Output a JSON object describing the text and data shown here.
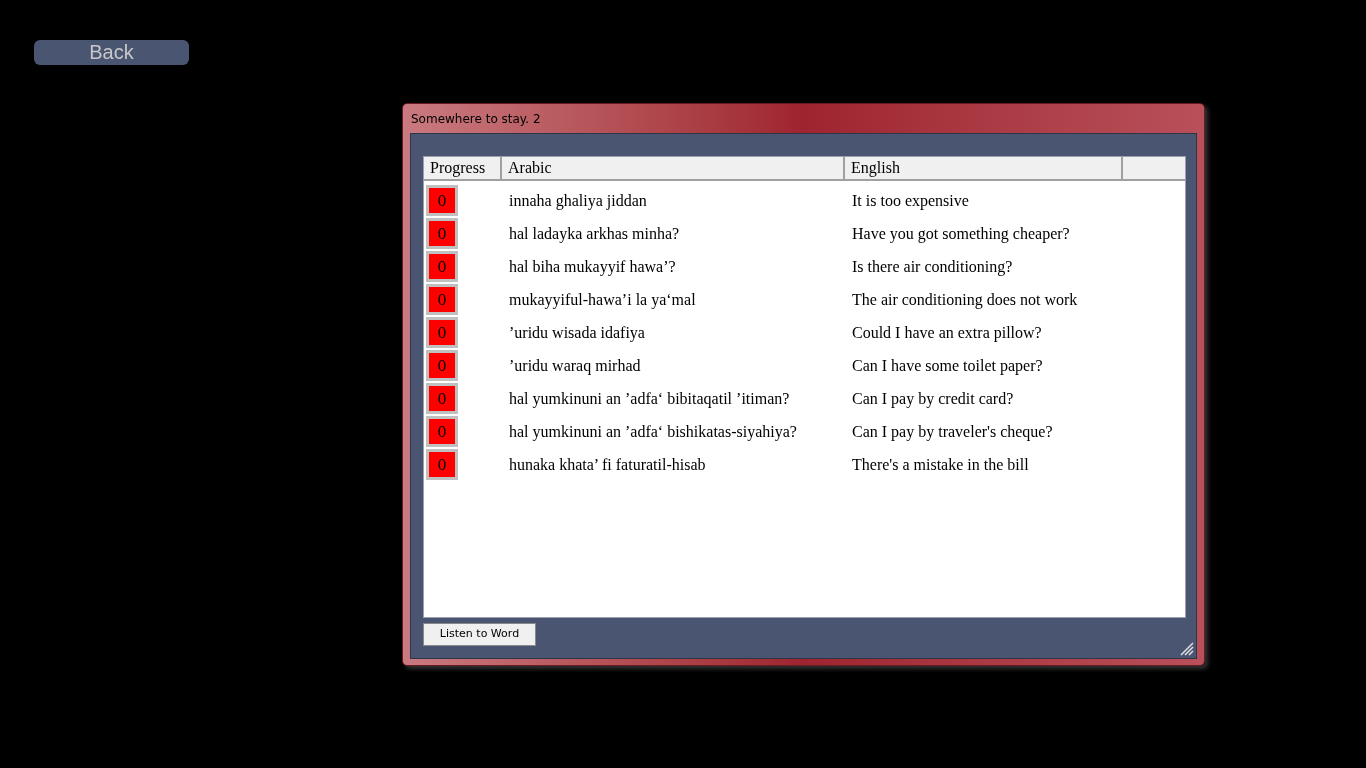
{
  "back_button": "Back",
  "window": {
    "title": "Somewhere to stay. 2"
  },
  "table": {
    "columns": [
      "Progress",
      "Arabic",
      "English"
    ],
    "rows": [
      {
        "progress": "0",
        "arabic": "innaha ghaliya jiddan",
        "english": "It is too expensive"
      },
      {
        "progress": "0",
        "arabic": "hal ladayka arkhas minha?",
        "english": "Have you got something cheaper?"
      },
      {
        "progress": "0",
        "arabic": "hal biha mukayyif hawa’?",
        "english": "Is there air conditioning?"
      },
      {
        "progress": "0",
        "arabic": "mukayyiful-hawa’i la ya‘mal",
        "english": "The air conditioning does not work"
      },
      {
        "progress": "0",
        "arabic": "’uridu wisada idafiya",
        "english": "Could I have an extra pillow?"
      },
      {
        "progress": "0",
        "arabic": "’uridu waraq mirhad",
        "english": "Can I have some toilet paper?"
      },
      {
        "progress": "0",
        "arabic": "hal yumkinuni an ’adfa‘ bibitaqatil ’itiman?",
        "english": "Can I pay by credit card?"
      },
      {
        "progress": "0",
        "arabic": "hal yumkinuni an ’adfa‘ bishikatas-siyahiya?",
        "english": "Can I pay by traveler's cheque?"
      },
      {
        "progress": "0",
        "arabic": "hunaka khata’ fi faturatil-hisab",
        "english": "There's a mistake in the bill"
      }
    ]
  },
  "listen_button": "Listen to Word"
}
